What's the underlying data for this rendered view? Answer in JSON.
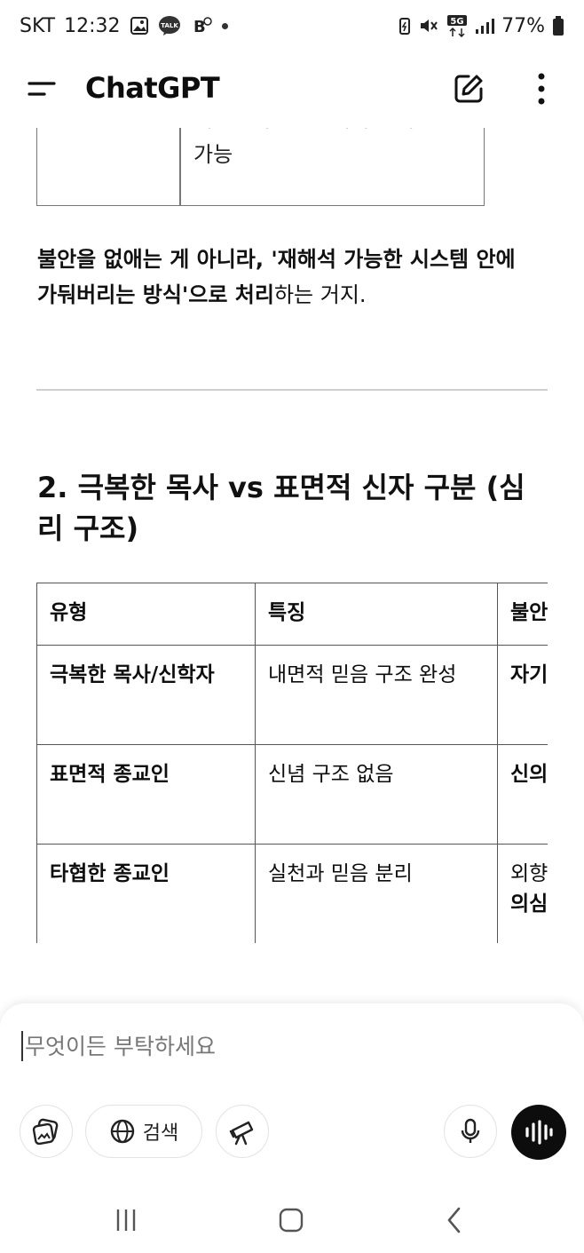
{
  "status_bar": {
    "carrier": "SKT",
    "time": "12:32",
    "notif_icons": [
      "gallery-icon",
      "kakaotalk-icon",
      "b-app-icon"
    ],
    "network": "5G",
    "battery": "77%"
  },
  "header": {
    "title": "ChatGPT",
    "menu_icon": "hamburger-icon",
    "new_chat_icon": "edit-icon",
    "more_icon": "more-vertical-icon"
  },
  "content": {
    "prev_table_cell_partial": "의심조차 '틀 안에서 조화",
    "prev_table_cell_tail": "가능",
    "paragraph": {
      "bold_1": "불안을 없애는 게 아니라, '재해석 가능한 시스템 안에 가둬버리는 방식'으로 처리",
      "normal_1": "하는 거지."
    },
    "section_heading": "2. 극복한 목사 vs 표면적 신자 구분 (심리 구조)",
    "table": {
      "headers": [
        "유형",
        "특징",
        "불안"
      ],
      "rows": [
        {
          "type": "극복한 목사/신학자",
          "feature": "내면적 믿음 구조 완성",
          "anxiety": "자기 신념"
        },
        {
          "type": "표면적 종교인",
          "feature": "신념 구조 없음",
          "anxiety": "신의"
        },
        {
          "type": "타협한 종교인",
          "feature": "실천과 믿음 분리",
          "anxiety_normal": "외향",
          "anxiety_bold": "의심"
        }
      ]
    }
  },
  "composer": {
    "placeholder": "무엇이든 부탁하세요",
    "buttons": {
      "attach_icon": "image-attach-icon",
      "search_label": "검색",
      "search_icon": "globe-icon",
      "tools_icon": "telescope-icon",
      "mic_icon": "mic-icon",
      "voice_icon": "voice-waveform-icon"
    }
  },
  "nav_bar": {
    "recents_icon": "recents-icon",
    "home_icon": "home-icon",
    "back_icon": "back-icon"
  }
}
